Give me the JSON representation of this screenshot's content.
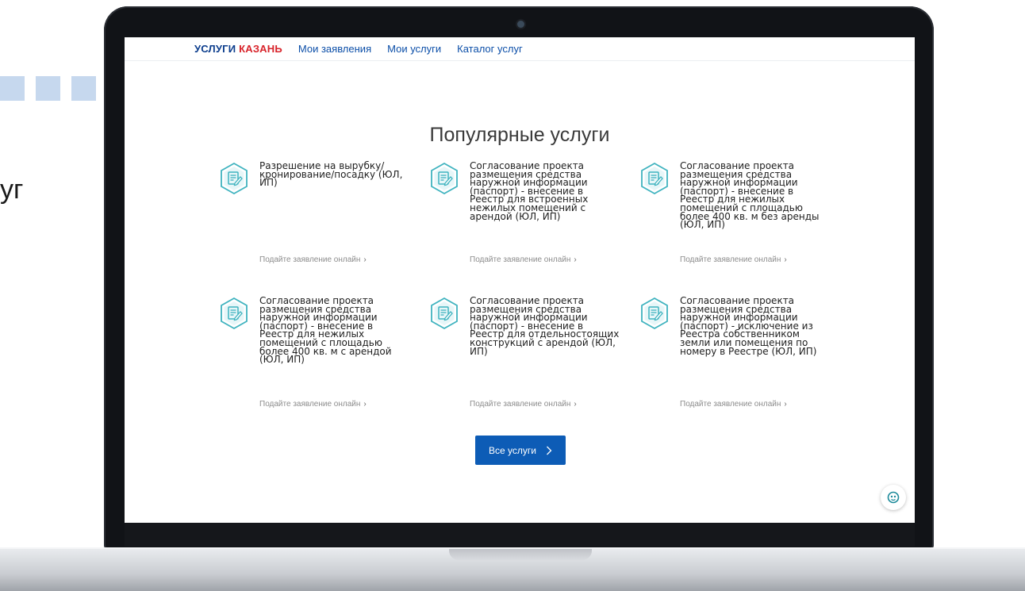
{
  "slide": {
    "partial_text": "уг"
  },
  "nav": {
    "logo_primary": "УСЛУГИ",
    "logo_city": "КАЗАНЬ",
    "links": [
      "Мои заявления",
      "Мои услуги",
      "Каталог услуг"
    ]
  },
  "section": {
    "title": "Популярные услуги"
  },
  "services": [
    {
      "title": "Разрешение на вырубку/ кронирование/посадку (ЮЛ, ИП)",
      "action": "Подайте заявление онлайн"
    },
    {
      "title": "Согласование проекта размещения средства наружной информации (паспорт) - внесение в Реестр для встроенных нежилых помещений с арендой (ЮЛ, ИП)",
      "action": "Подайте заявление онлайн"
    },
    {
      "title": "Согласование проекта размещения средства наружной информации (паспорт) - внесение в Реестр для нежилых помещений с площадью более 400 кв. м без аренды (ЮЛ, ИП)",
      "action": "Подайте заявление онлайн"
    },
    {
      "title": "Согласование проекта размещения средства наружной информации (паспорт) - внесение в Реестр для нежилых помещений с площадью более 400 кв. м с арендой (ЮЛ, ИП)",
      "action": "Подайте заявление онлайн"
    },
    {
      "title": "Согласование проекта размещения средства наружной информации (паспорт) - внесение в Реестр для отдельностоящих конструкций с арендой (ЮЛ, ИП)",
      "action": "Подайте заявление онлайн"
    },
    {
      "title": "Согласование проекта размещения средства наружной информации (паспорт) - исключение из Реестра собственником земли или помещения по номеру в Реестре (ЮЛ, ИП)",
      "action": "Подайте заявление онлайн"
    }
  ],
  "all_services_button": "Все услуги",
  "icons": {
    "service": "document-edit-icon",
    "chevron": "chevron-right-icon",
    "help": "accessibility-icon"
  },
  "colors": {
    "accent": "#0d5cb6",
    "logo_blue": "#0b3c8c",
    "logo_red": "#d8232a",
    "icon_teal": "#3fb3bf"
  }
}
